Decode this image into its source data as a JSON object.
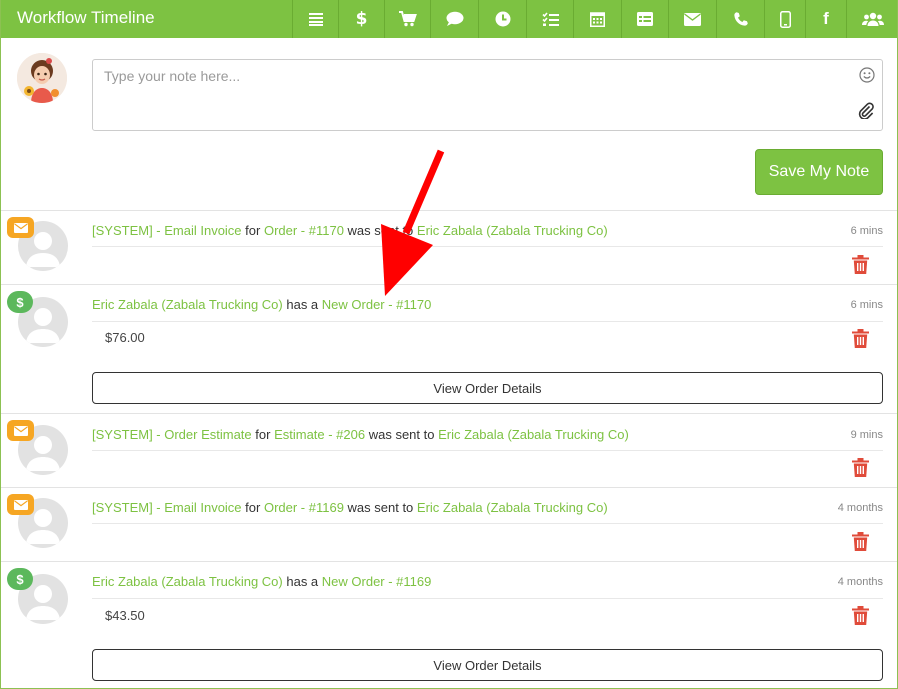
{
  "header": {
    "title": "Workflow Timeline",
    "toolbar_icons": [
      "list-icon",
      "dollar-icon",
      "cart-icon",
      "comment-icon",
      "clock-icon",
      "tasks-icon",
      "calendar-icon",
      "table-icon",
      "envelope-icon",
      "phone-icon",
      "mobile-icon",
      "facebook-icon",
      "users-icon"
    ]
  },
  "composer": {
    "placeholder": "Type your note here...",
    "save_label": "Save My Note"
  },
  "entries": [
    {
      "badge": "email",
      "parts": [
        {
          "t": "[SYSTEM] - Email Invoice",
          "link": true
        },
        {
          "t": " for ",
          "link": false
        },
        {
          "t": "Order - #1170",
          "link": true
        },
        {
          "t": " was sent to ",
          "link": false
        },
        {
          "t": "Eric Zabala (Zabala Trucking Co)",
          "link": true
        }
      ],
      "time": "6 mins"
    },
    {
      "badge": "dollar",
      "parts": [
        {
          "t": "Eric Zabala (Zabala Trucking Co)",
          "link": true
        },
        {
          "t": " has a ",
          "link": false
        },
        {
          "t": "New Order - #1170",
          "link": true
        }
      ],
      "time": "6 mins",
      "amount": "$76.00",
      "button": "View Order Details"
    },
    {
      "badge": "email",
      "parts": [
        {
          "t": "[SYSTEM] - Order Estimate",
          "link": true
        },
        {
          "t": " for ",
          "link": false
        },
        {
          "t": "Estimate - #206",
          "link": true
        },
        {
          "t": " was sent to ",
          "link": false
        },
        {
          "t": "Eric Zabala (Zabala Trucking Co)",
          "link": true
        }
      ],
      "time": "9 mins"
    },
    {
      "badge": "email",
      "parts": [
        {
          "t": "[SYSTEM] - Email Invoice",
          "link": true
        },
        {
          "t": " for ",
          "link": false
        },
        {
          "t": "Order - #1169",
          "link": true
        },
        {
          "t": " was sent to ",
          "link": false
        },
        {
          "t": "Eric Zabala (Zabala Trucking Co)",
          "link": true
        }
      ],
      "time": "4 months"
    },
    {
      "badge": "dollar",
      "parts": [
        {
          "t": "Eric Zabala (Zabala Trucking Co)",
          "link": true
        },
        {
          "t": " has a ",
          "link": false
        },
        {
          "t": "New Order - #1169",
          "link": true
        }
      ],
      "time": "4 months",
      "amount": "$43.50",
      "button": "View Order Details"
    }
  ],
  "colors": {
    "accent": "#7dc242",
    "email_badge": "#f6a623",
    "order_badge": "#5cb85c",
    "trash": "#e04b3a",
    "annotation_arrow": "#ff0000"
  }
}
